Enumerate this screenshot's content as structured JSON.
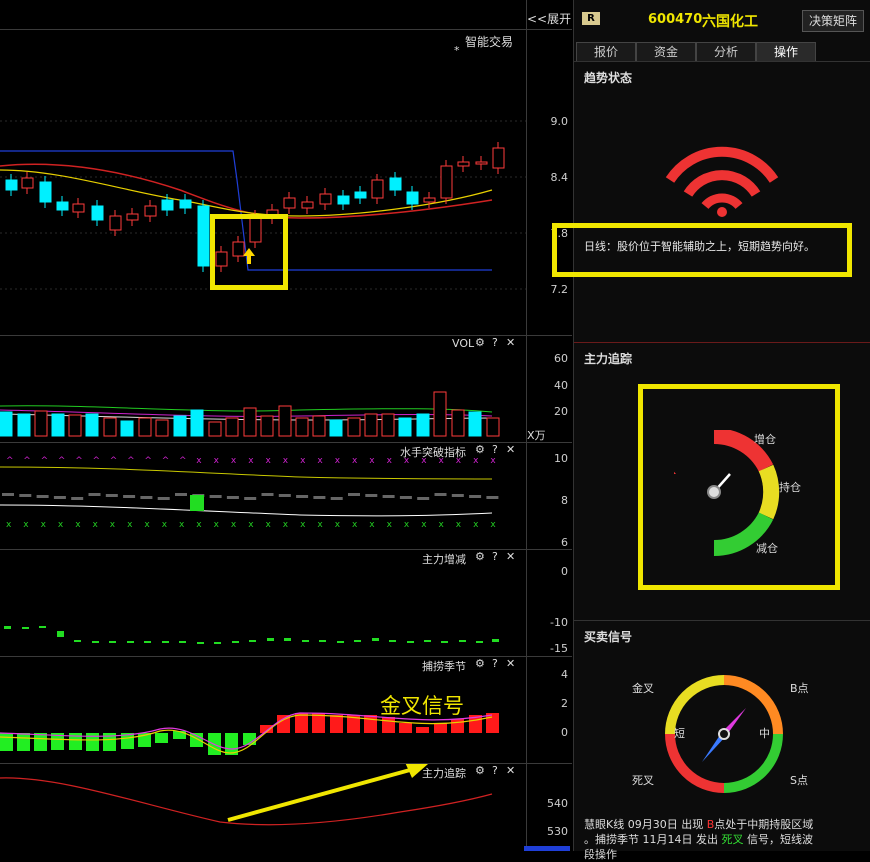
{
  "toolbar": {
    "expand_label": "<<展开"
  },
  "stock": {
    "badge": "R",
    "code": "600470",
    "name": "六国化工",
    "decision_button": "决策矩阵"
  },
  "tabs": [
    {
      "label": "报价"
    },
    {
      "label": "资金"
    },
    {
      "label": "分析"
    },
    {
      "label": "操作"
    }
  ],
  "active_tab": "操作",
  "main_chart": {
    "title": "智能交易",
    "marker": "*",
    "yticks": [
      "9.0",
      "8.4",
      "7.8",
      "7.2"
    ]
  },
  "vol": {
    "title": "VOL",
    "yticks": [
      "60",
      "40",
      "20"
    ],
    "unit": "X万"
  },
  "shuishou": {
    "title": "水手突破指标",
    "yticks": [
      "10",
      "8",
      "6"
    ]
  },
  "zlzj": {
    "title": "主力增减",
    "yticks": [
      "0",
      "-10",
      "-15"
    ]
  },
  "bulao": {
    "title": "捕捞季节",
    "yticks": [
      "4",
      "2",
      "0"
    ],
    "annotation": "金叉信号"
  },
  "zlzz": {
    "title": "主力追踪",
    "yticks": [
      "540",
      "530"
    ]
  },
  "trend": {
    "title": "趋势状态",
    "text": "日线：股价位于智能辅助之上，短期趋势向好。"
  },
  "tracking": {
    "title": "主力追踪",
    "labels": {
      "increase": "增仓",
      "hold": "持仓",
      "decrease": "减仓"
    }
  },
  "signal": {
    "title": "买卖信号",
    "labels": {
      "golden": "金叉",
      "b": "B点",
      "short": "短",
      "mid": "中",
      "death": "死叉",
      "s": "S点"
    },
    "line1": {
      "prefix": "慧眼K线  09月30日  出现  ",
      "mark": "B",
      "suffix": "点处于中期持股区域"
    },
    "line2": {
      "prefix": "。捕捞季节  11月14日  发出  ",
      "mark": "死叉",
      "suffix": "  信号，短线波"
    },
    "line3": "段操作"
  },
  "colors": {
    "up": "#ff3b3b",
    "down": "#00f0ff",
    "accent": "#f0e600",
    "green": "#22dd22"
  }
}
